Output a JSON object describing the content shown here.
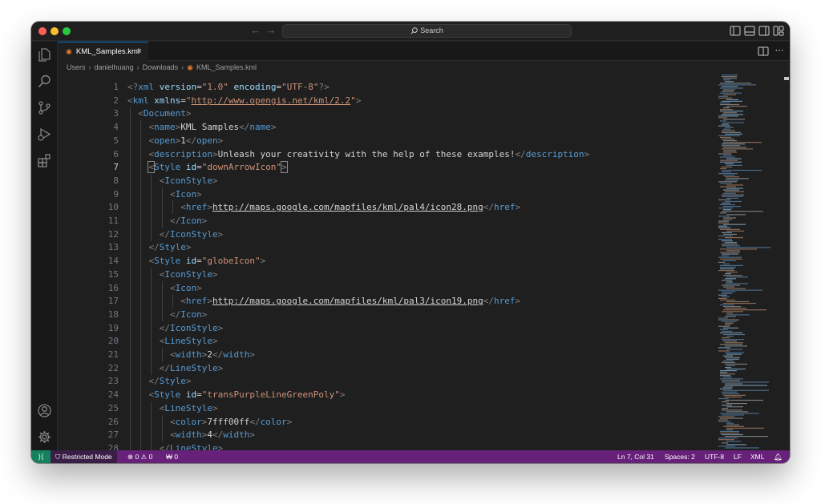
{
  "titlebar": {
    "search_placeholder": "Search"
  },
  "tab": {
    "label": "KML_Samples.kml",
    "icon": "rss-icon",
    "close": "×"
  },
  "breadcrumb": [
    "Users",
    "danielhuang",
    "Downloads",
    "KML_Samples.kml"
  ],
  "editor": {
    "active_line": 7,
    "lines": [
      {
        "n": "1",
        "indent": 0,
        "tokens": [
          {
            "c": "t-punct",
            "t": "<?"
          },
          {
            "c": "t-tag",
            "t": "xml"
          },
          {
            "c": "t-text",
            "t": " "
          },
          {
            "c": "t-attr",
            "t": "version"
          },
          {
            "c": "t-text",
            "t": "="
          },
          {
            "c": "t-str",
            "t": "\"1.0\""
          },
          {
            "c": "t-text",
            "t": " "
          },
          {
            "c": "t-attr",
            "t": "encoding"
          },
          {
            "c": "t-text",
            "t": "="
          },
          {
            "c": "t-str",
            "t": "\"UTF-8\""
          },
          {
            "c": "t-punct",
            "t": "?>"
          }
        ]
      },
      {
        "n": "2",
        "indent": 0,
        "tokens": [
          {
            "c": "t-punct",
            "t": "<"
          },
          {
            "c": "t-tag",
            "t": "kml"
          },
          {
            "c": "t-text",
            "t": " "
          },
          {
            "c": "t-attr",
            "t": "xmlns"
          },
          {
            "c": "t-text",
            "t": "="
          },
          {
            "c": "t-str",
            "t": "\""
          },
          {
            "c": "t-str",
            "t": "http://www.opengis.net/kml/2.2",
            "u": true
          },
          {
            "c": "t-str",
            "t": "\""
          },
          {
            "c": "t-punct",
            "t": ">"
          }
        ]
      },
      {
        "n": "3",
        "indent": 1,
        "tokens": [
          {
            "c": "t-punct",
            "t": "<"
          },
          {
            "c": "t-tag",
            "t": "Document"
          },
          {
            "c": "t-punct",
            "t": ">"
          }
        ]
      },
      {
        "n": "4",
        "indent": 2,
        "tokens": [
          {
            "c": "t-punct",
            "t": "<"
          },
          {
            "c": "t-tag",
            "t": "name"
          },
          {
            "c": "t-punct",
            "t": ">"
          },
          {
            "c": "t-text",
            "t": "KML Samples"
          },
          {
            "c": "t-punct",
            "t": "</"
          },
          {
            "c": "t-tag",
            "t": "name"
          },
          {
            "c": "t-punct",
            "t": ">"
          }
        ]
      },
      {
        "n": "5",
        "indent": 2,
        "tokens": [
          {
            "c": "t-punct",
            "t": "<"
          },
          {
            "c": "t-tag",
            "t": "open"
          },
          {
            "c": "t-punct",
            "t": ">"
          },
          {
            "c": "t-text",
            "t": "1"
          },
          {
            "c": "t-punct",
            "t": "</"
          },
          {
            "c": "t-tag",
            "t": "open"
          },
          {
            "c": "t-punct",
            "t": ">"
          }
        ]
      },
      {
        "n": "6",
        "indent": 2,
        "tokens": [
          {
            "c": "t-punct",
            "t": "<"
          },
          {
            "c": "t-tag",
            "t": "description"
          },
          {
            "c": "t-punct",
            "t": ">"
          },
          {
            "c": "t-text",
            "t": "Unleash your creativity with the help of these examples!"
          },
          {
            "c": "t-punct",
            "t": "</"
          },
          {
            "c": "t-tag",
            "t": "description"
          },
          {
            "c": "t-punct",
            "t": ">"
          }
        ]
      },
      {
        "n": "7",
        "indent": 2,
        "tokens": [
          {
            "c": "t-punct",
            "t": "<",
            "h": true
          },
          {
            "c": "t-tag",
            "t": "Style"
          },
          {
            "c": "t-text",
            "t": " "
          },
          {
            "c": "t-attr",
            "t": "id"
          },
          {
            "c": "t-text",
            "t": "="
          },
          {
            "c": "t-str",
            "t": "\"downArrowIcon\""
          },
          {
            "c": "t-punct",
            "t": ">",
            "h": true
          }
        ]
      },
      {
        "n": "8",
        "indent": 3,
        "tokens": [
          {
            "c": "t-punct",
            "t": "<"
          },
          {
            "c": "t-tag",
            "t": "IconStyle"
          },
          {
            "c": "t-punct",
            "t": ">"
          }
        ]
      },
      {
        "n": "9",
        "indent": 4,
        "tokens": [
          {
            "c": "t-punct",
            "t": "<"
          },
          {
            "c": "t-tag",
            "t": "Icon"
          },
          {
            "c": "t-punct",
            "t": ">"
          }
        ]
      },
      {
        "n": "10",
        "indent": 5,
        "tokens": [
          {
            "c": "t-punct",
            "t": "<"
          },
          {
            "c": "t-tag",
            "t": "href"
          },
          {
            "c": "t-punct",
            "t": ">"
          },
          {
            "c": "t-link",
            "t": "http://maps.google.com/mapfiles/kml/pal4/icon28.png"
          },
          {
            "c": "t-punct",
            "t": "</"
          },
          {
            "c": "t-tag",
            "t": "href"
          },
          {
            "c": "t-punct",
            "t": ">"
          }
        ]
      },
      {
        "n": "11",
        "indent": 4,
        "tokens": [
          {
            "c": "t-punct",
            "t": "</"
          },
          {
            "c": "t-tag",
            "t": "Icon"
          },
          {
            "c": "t-punct",
            "t": ">"
          }
        ]
      },
      {
        "n": "12",
        "indent": 3,
        "tokens": [
          {
            "c": "t-punct",
            "t": "</"
          },
          {
            "c": "t-tag",
            "t": "IconStyle"
          },
          {
            "c": "t-punct",
            "t": ">"
          }
        ]
      },
      {
        "n": "13",
        "indent": 2,
        "tokens": [
          {
            "c": "t-punct",
            "t": "</"
          },
          {
            "c": "t-tag",
            "t": "Style"
          },
          {
            "c": "t-punct",
            "t": ">"
          }
        ]
      },
      {
        "n": "14",
        "indent": 2,
        "tokens": [
          {
            "c": "t-punct",
            "t": "<"
          },
          {
            "c": "t-tag",
            "t": "Style"
          },
          {
            "c": "t-text",
            "t": " "
          },
          {
            "c": "t-attr",
            "t": "id"
          },
          {
            "c": "t-text",
            "t": "="
          },
          {
            "c": "t-str",
            "t": "\"globeIcon\""
          },
          {
            "c": "t-punct",
            "t": ">"
          }
        ]
      },
      {
        "n": "15",
        "indent": 3,
        "tokens": [
          {
            "c": "t-punct",
            "t": "<"
          },
          {
            "c": "t-tag",
            "t": "IconStyle"
          },
          {
            "c": "t-punct",
            "t": ">"
          }
        ]
      },
      {
        "n": "16",
        "indent": 4,
        "tokens": [
          {
            "c": "t-punct",
            "t": "<"
          },
          {
            "c": "t-tag",
            "t": "Icon"
          },
          {
            "c": "t-punct",
            "t": ">"
          }
        ]
      },
      {
        "n": "17",
        "indent": 5,
        "tokens": [
          {
            "c": "t-punct",
            "t": "<"
          },
          {
            "c": "t-tag",
            "t": "href"
          },
          {
            "c": "t-punct",
            "t": ">"
          },
          {
            "c": "t-link",
            "t": "http://maps.google.com/mapfiles/kml/pal3/icon19.png"
          },
          {
            "c": "t-punct",
            "t": "</"
          },
          {
            "c": "t-tag",
            "t": "href"
          },
          {
            "c": "t-punct",
            "t": ">"
          }
        ]
      },
      {
        "n": "18",
        "indent": 4,
        "tokens": [
          {
            "c": "t-punct",
            "t": "</"
          },
          {
            "c": "t-tag",
            "t": "Icon"
          },
          {
            "c": "t-punct",
            "t": ">"
          }
        ]
      },
      {
        "n": "19",
        "indent": 3,
        "tokens": [
          {
            "c": "t-punct",
            "t": "</"
          },
          {
            "c": "t-tag",
            "t": "IconStyle"
          },
          {
            "c": "t-punct",
            "t": ">"
          }
        ]
      },
      {
        "n": "20",
        "indent": 3,
        "tokens": [
          {
            "c": "t-punct",
            "t": "<"
          },
          {
            "c": "t-tag",
            "t": "LineStyle"
          },
          {
            "c": "t-punct",
            "t": ">"
          }
        ]
      },
      {
        "n": "21",
        "indent": 4,
        "tokens": [
          {
            "c": "t-punct",
            "t": "<"
          },
          {
            "c": "t-tag",
            "t": "width"
          },
          {
            "c": "t-punct",
            "t": ">"
          },
          {
            "c": "t-text",
            "t": "2"
          },
          {
            "c": "t-punct",
            "t": "</"
          },
          {
            "c": "t-tag",
            "t": "width"
          },
          {
            "c": "t-punct",
            "t": ">"
          }
        ]
      },
      {
        "n": "22",
        "indent": 3,
        "tokens": [
          {
            "c": "t-punct",
            "t": "</"
          },
          {
            "c": "t-tag",
            "t": "LineStyle"
          },
          {
            "c": "t-punct",
            "t": ">"
          }
        ]
      },
      {
        "n": "23",
        "indent": 2,
        "tokens": [
          {
            "c": "t-punct",
            "t": "</"
          },
          {
            "c": "t-tag",
            "t": "Style"
          },
          {
            "c": "t-punct",
            "t": ">"
          }
        ]
      },
      {
        "n": "24",
        "indent": 2,
        "tokens": [
          {
            "c": "t-punct",
            "t": "<"
          },
          {
            "c": "t-tag",
            "t": "Style"
          },
          {
            "c": "t-text",
            "t": " "
          },
          {
            "c": "t-attr",
            "t": "id"
          },
          {
            "c": "t-text",
            "t": "="
          },
          {
            "c": "t-str",
            "t": "\"transPurpleLineGreenPoly\""
          },
          {
            "c": "t-punct",
            "t": ">"
          }
        ]
      },
      {
        "n": "25",
        "indent": 3,
        "tokens": [
          {
            "c": "t-punct",
            "t": "<"
          },
          {
            "c": "t-tag",
            "t": "LineStyle"
          },
          {
            "c": "t-punct",
            "t": ">"
          }
        ]
      },
      {
        "n": "26",
        "indent": 4,
        "tokens": [
          {
            "c": "t-punct",
            "t": "<"
          },
          {
            "c": "t-tag",
            "t": "color"
          },
          {
            "c": "t-punct",
            "t": ">"
          },
          {
            "c": "t-text",
            "t": "7fff00ff"
          },
          {
            "c": "t-punct",
            "t": "</"
          },
          {
            "c": "t-tag",
            "t": "color"
          },
          {
            "c": "t-punct",
            "t": ">"
          }
        ]
      },
      {
        "n": "27",
        "indent": 4,
        "tokens": [
          {
            "c": "t-punct",
            "t": "<"
          },
          {
            "c": "t-tag",
            "t": "width"
          },
          {
            "c": "t-punct",
            "t": ">"
          },
          {
            "c": "t-text",
            "t": "4"
          },
          {
            "c": "t-punct",
            "t": "</"
          },
          {
            "c": "t-tag",
            "t": "width"
          },
          {
            "c": "t-punct",
            "t": ">"
          }
        ]
      },
      {
        "n": "28",
        "indent": 3,
        "tokens": [
          {
            "c": "t-punct",
            "t": "</"
          },
          {
            "c": "t-tag",
            "t": "LineStyle"
          },
          {
            "c": "t-punct",
            "t": ">"
          }
        ]
      }
    ]
  },
  "statusbar": {
    "restricted": "Restricted Mode",
    "errors": "0",
    "warnings": "0",
    "ports": "0",
    "position": "Ln 7, Col 31",
    "spaces": "Spaces: 2",
    "encoding": "UTF-8",
    "eol": "LF",
    "language": "XML"
  },
  "colors": {
    "statusbar": "#68217a",
    "remote": "#16825d",
    "accent": "#0078d4",
    "tag": "#569cd6",
    "attr": "#9cdcfe",
    "string": "#ce9178"
  }
}
